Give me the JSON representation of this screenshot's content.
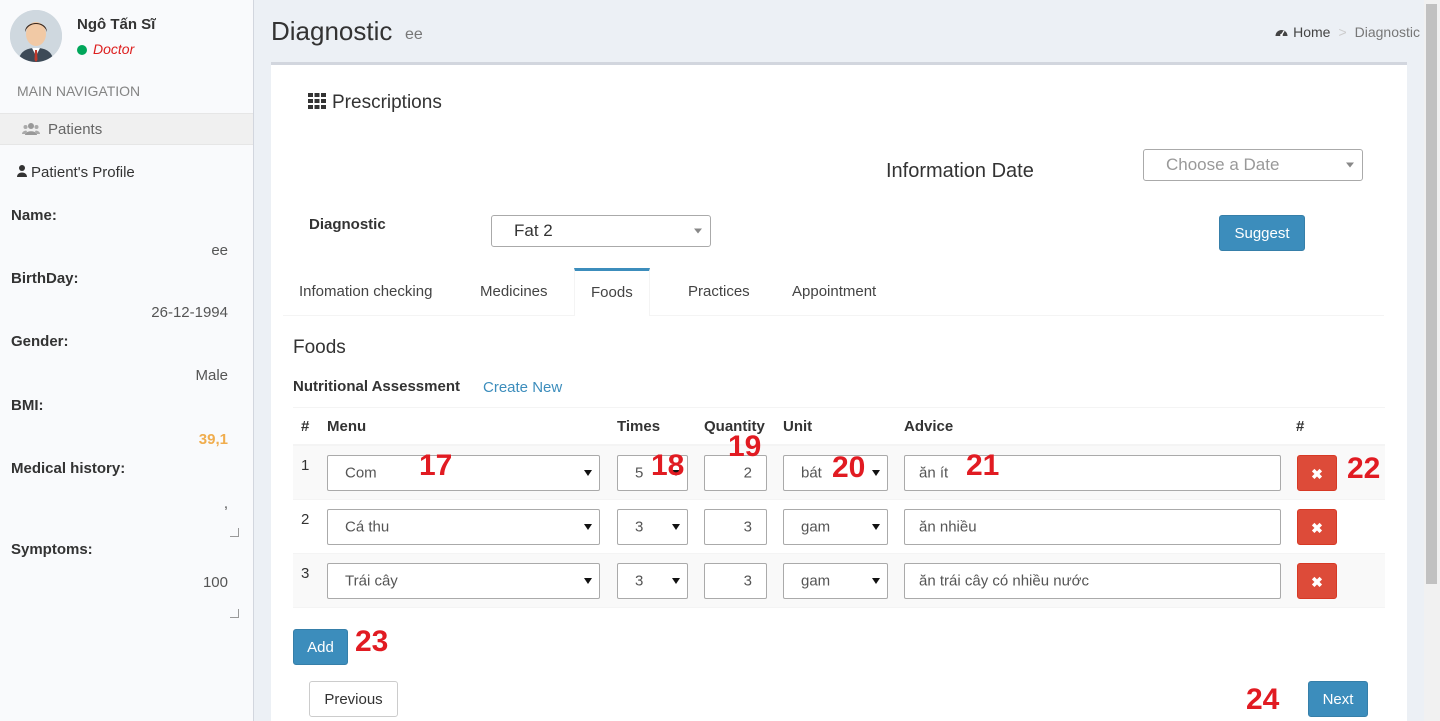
{
  "user": {
    "name": "Ngô Tấn Sĩ",
    "role": "Doctor"
  },
  "nav": {
    "header": "MAIN NAVIGATION",
    "patients_label": "Patients"
  },
  "profile": {
    "title": "Patient's Profile",
    "fields": [
      {
        "label": "Name:",
        "value": "ee"
      },
      {
        "label": "BirthDay:",
        "value": "26-12-1994"
      },
      {
        "label": "Gender:",
        "value": "Male"
      },
      {
        "label": "BMI:",
        "value": "39,1"
      },
      {
        "label": "Medical history:",
        "value": ","
      },
      {
        "label": "Symptoms:",
        "value": "100"
      }
    ]
  },
  "header": {
    "title": "Diagnostic",
    "subtitle": "ee"
  },
  "breadcrumb": {
    "home": "Home",
    "current": "Diagnostic"
  },
  "box": {
    "title": "Prescriptions"
  },
  "info_date": {
    "label": "Information Date",
    "placeholder": "Choose a Date"
  },
  "diagnostic": {
    "label": "Diagnostic",
    "value": "Fat 2",
    "suggest_label": "Suggest"
  },
  "tabs": [
    {
      "label": "Infomation checking"
    },
    {
      "label": "Medicines"
    },
    {
      "label": "Foods"
    },
    {
      "label": "Practices"
    },
    {
      "label": "Appointment"
    }
  ],
  "foods": {
    "title": "Foods",
    "nutri_label": "Nutritional Assessment",
    "create_new": "Create New",
    "columns": [
      "#",
      "Menu",
      "Times",
      "Quantity",
      "Unit",
      "Advice",
      "#"
    ],
    "rows": [
      {
        "num": "1",
        "menu": "Com",
        "times": "5",
        "quantity": "2",
        "unit": "bát",
        "advice": "ăn ít",
        "delete": "✖"
      },
      {
        "num": "2",
        "menu": "Cá thu",
        "times": "3",
        "quantity": "3",
        "unit": "gam",
        "advice": "ăn nhiều",
        "delete": "✖"
      },
      {
        "num": "3",
        "menu": "Trái cây",
        "times": "3",
        "quantity": "3",
        "unit": "gam",
        "advice": "ăn trái cây có nhiều nước",
        "delete": "✖"
      }
    ],
    "add_label": "Add"
  },
  "pager": {
    "previous": "Previous",
    "next": "Next"
  },
  "annotations": [
    "17",
    "18",
    "19",
    "20",
    "21",
    "22",
    "23",
    "24"
  ]
}
